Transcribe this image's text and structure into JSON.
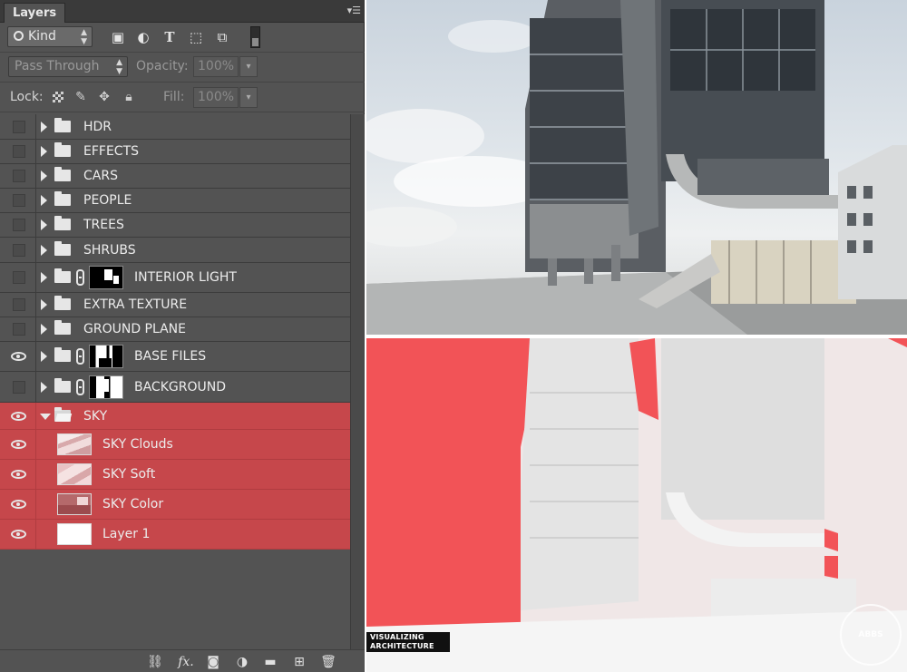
{
  "panel": {
    "tab_label": "Layers",
    "menu_icon": "panel-menu-icon",
    "filter": {
      "kind_label": "Kind",
      "icons": [
        "pixel-filter-icon",
        "adjustment-filter-icon",
        "type-filter-icon",
        "shape-filter-icon",
        "smart-object-filter-icon"
      ]
    },
    "blend": {
      "mode": "Pass Through",
      "opacity_label": "Opacity:",
      "opacity_value": "100%"
    },
    "lock": {
      "label": "Lock:",
      "fill_label": "Fill:",
      "fill_value": "100%"
    }
  },
  "layers": [
    {
      "name": "HDR",
      "visible": false,
      "type": "group",
      "expanded": false
    },
    {
      "name": "EFFECTS",
      "visible": false,
      "type": "group",
      "expanded": false
    },
    {
      "name": "CARS",
      "visible": false,
      "type": "group",
      "expanded": false
    },
    {
      "name": "PEOPLE",
      "visible": false,
      "type": "group",
      "expanded": false
    },
    {
      "name": "TREES",
      "visible": false,
      "type": "group",
      "expanded": false
    },
    {
      "name": "SHRUBS",
      "visible": false,
      "type": "group",
      "expanded": false
    },
    {
      "name": "INTERIOR LIGHT",
      "visible": false,
      "type": "group-mask",
      "expanded": false
    },
    {
      "name": "EXTRA TEXTURE",
      "visible": false,
      "type": "group",
      "expanded": false
    },
    {
      "name": "GROUND PLANE",
      "visible": false,
      "type": "group",
      "expanded": false
    },
    {
      "name": "BASE FILES",
      "visible": true,
      "type": "group-mask",
      "expanded": false
    },
    {
      "name": "BACKGROUND",
      "visible": false,
      "type": "group-mask",
      "expanded": false
    },
    {
      "name": "SKY",
      "visible": true,
      "type": "group",
      "expanded": true,
      "selected": true
    },
    {
      "name": "SKY Clouds",
      "visible": true,
      "type": "layer",
      "selected": true
    },
    {
      "name": "SKY Soft",
      "visible": true,
      "type": "layer",
      "selected": true
    },
    {
      "name": "SKY Color",
      "visible": true,
      "type": "layer",
      "selected": true
    },
    {
      "name": "Layer 1",
      "visible": true,
      "type": "layer",
      "selected": true
    }
  ],
  "toolbar": {
    "icons": [
      "link-layers-icon",
      "add-style-icon",
      "add-mask-icon",
      "adjustment-layer-icon",
      "new-group-icon",
      "new-layer-icon",
      "delete-layer-icon"
    ],
    "fx_label": "fx."
  },
  "render": {
    "credit_line1": "VISUALIZING",
    "credit_line2": "ARCHITECTURE",
    "colors": {
      "mask_red": "#f25357",
      "selection": "#c6474b",
      "panel_bg": "#535353"
    }
  }
}
